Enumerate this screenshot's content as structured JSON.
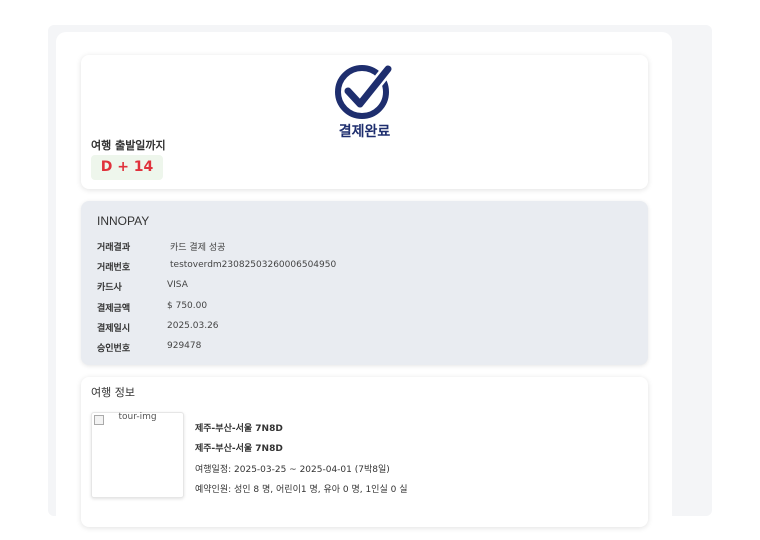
{
  "status": {
    "title": "결제완료",
    "dday_label": "여행 출발일까지",
    "dday_value": "D + 14",
    "icon": "check-circle-icon",
    "colors": {
      "navy": "#1e2e6e",
      "badge_text": "#e0323c",
      "badge_bg": "#eef6ec"
    }
  },
  "payment": {
    "provider": "INNOPAY",
    "rows": [
      {
        "label": "거래결과",
        "value": "카드 결제 성공"
      },
      {
        "label": "거래번호",
        "value": "testoverdm23082503260006504950"
      },
      {
        "label": "카드사",
        "value": "VISA"
      },
      {
        "label": "결제금액",
        "value": "$ 750.00"
      },
      {
        "label": "결제일시",
        "value": "2025.03.26"
      },
      {
        "label": "승인번호",
        "value": "929478"
      }
    ]
  },
  "trip": {
    "section_title": "여행 정보",
    "image_alt": "tour-img",
    "name": "제주-부산-서울 7N8D",
    "subtitle": "제주-부산-서울 7N8D",
    "schedule": "여행일정: 2025-03-25 ~ 2025-04-01 (7박8일)",
    "travelers": "예약인원: 성인 8 명, 어린이1 명, 유아 0 명, 1인실 0 실"
  }
}
